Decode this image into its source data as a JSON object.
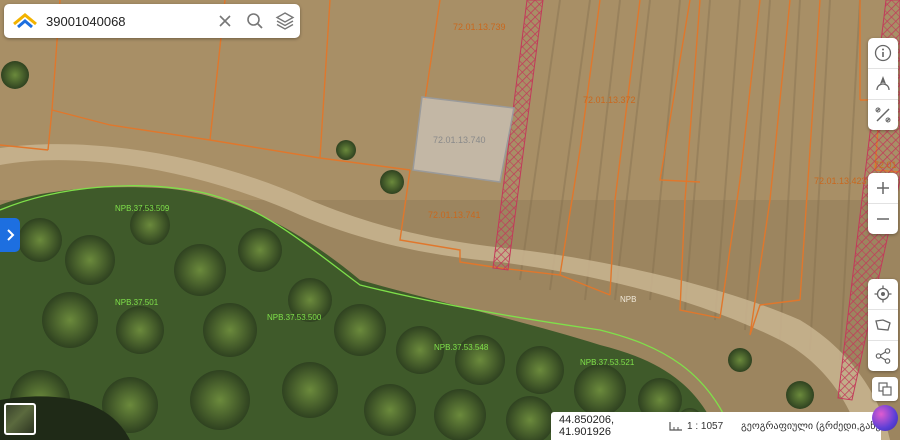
{
  "search": {
    "value": "39001040068"
  },
  "parcels": [
    {
      "id": "72.01.13.739"
    },
    {
      "id": "72.01.13.372"
    },
    {
      "id": "72.01.13.740"
    },
    {
      "id": "72.01.13.741"
    },
    {
      "id": "72.01.13.423"
    },
    {
      "id": "72.01"
    }
  ],
  "zones": [
    {
      "label": "NPB.37.53.509"
    },
    {
      "label": "NPB.37.501"
    },
    {
      "label": "NPB.37.53.500"
    },
    {
      "label": "NPB.37.53.548"
    },
    {
      "label": "NPB.37.53.521"
    }
  ],
  "road_label": "NPB",
  "status": {
    "coords": "44.850206, 41.901926",
    "scale": "1 : 1057",
    "address": "გეოგრაფიული (გრძედი,განედი)"
  },
  "colors": {
    "parcel_line": "#e0772c",
    "parcel_label": "#c9681e",
    "zone_line": "#7fe04a",
    "hatch": "#c23a5a",
    "accent": "#1d6fe0"
  },
  "icons": [
    "logo-icon",
    "close-icon",
    "search-icon",
    "layers-icon",
    "chevron-right-icon",
    "info-icon",
    "compass-icon",
    "measure-icon",
    "zoom-in-icon",
    "zoom-out-icon",
    "locate-icon",
    "area-icon",
    "share-icon",
    "layers-mini-icon",
    "ai-assistant-icon"
  ]
}
